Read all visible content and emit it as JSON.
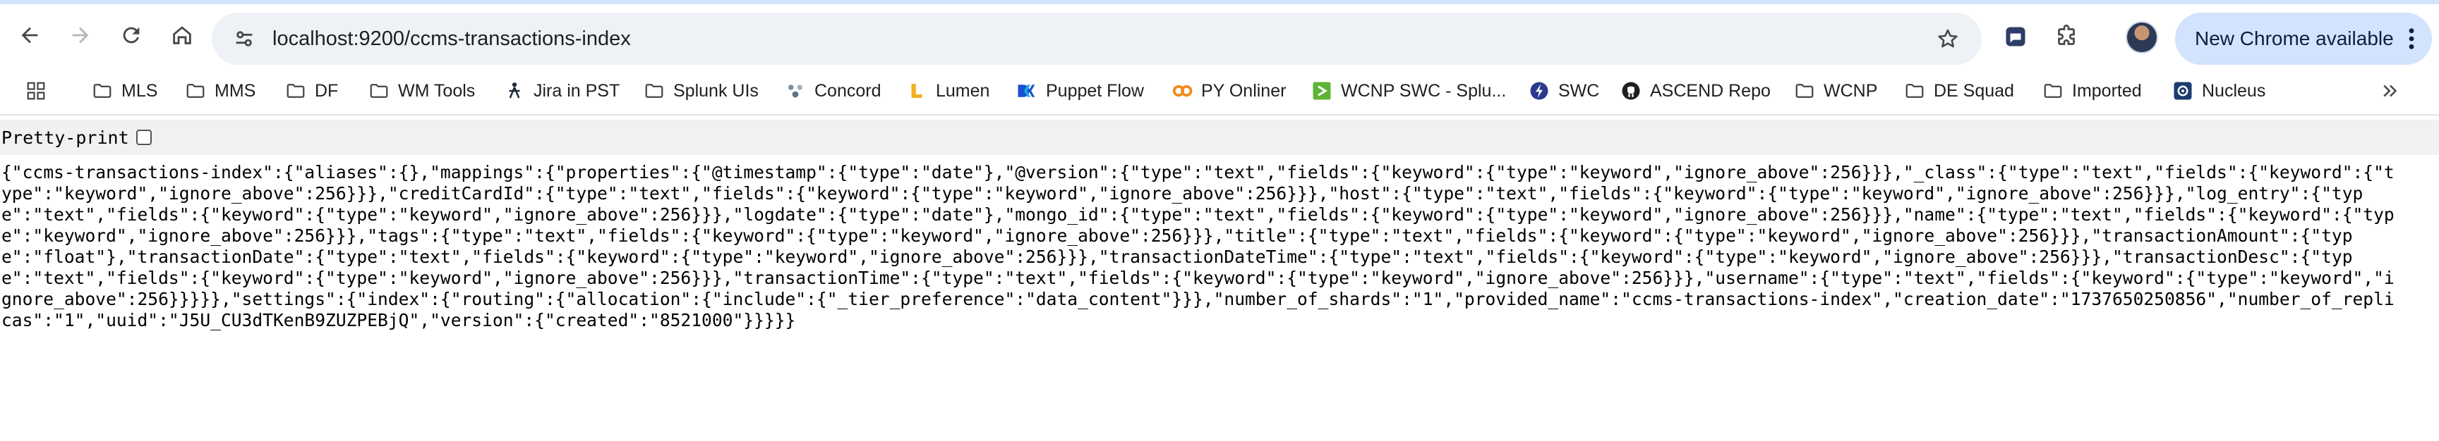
{
  "browser": {
    "url": "localhost:9200/ccms-transactions-index",
    "update_label": "New Chrome available"
  },
  "bookmarks": [
    {
      "label": "MLS",
      "icon": "folder-icon"
    },
    {
      "label": "MMS",
      "icon": "folder-icon"
    },
    {
      "label": "DF",
      "icon": "folder-icon"
    },
    {
      "label": "WM Tools",
      "icon": "folder-icon"
    },
    {
      "label": "Jira in PST",
      "icon": "jira-icon"
    },
    {
      "label": "Splunk UIs",
      "icon": "folder-icon"
    },
    {
      "label": "Concord",
      "icon": "concord-icon"
    },
    {
      "label": "Lumen",
      "icon": "lumen-icon"
    },
    {
      "label": "Puppet Flow",
      "icon": "dk-icon"
    },
    {
      "label": "PY Onliner",
      "icon": "co-icon"
    },
    {
      "label": "WCNP SWC - Splu...",
      "icon": "splunk-icon"
    },
    {
      "label": "SWC",
      "icon": "swc-icon"
    },
    {
      "label": "ASCEND Repo",
      "icon": "github-icon"
    },
    {
      "label": "WCNP",
      "icon": "folder-icon"
    },
    {
      "label": "DE Squad",
      "icon": "folder-icon"
    },
    {
      "label": "Imported",
      "icon": "folder-icon"
    },
    {
      "label": "Nucleus",
      "icon": "nucleus-icon"
    }
  ],
  "page": {
    "pretty_print_label": "Pretty-print",
    "pretty_print_checked": false,
    "json_text": "{\"ccms-transactions-index\":{\"aliases\":{},\"mappings\":{\"properties\":{\"@timestamp\":{\"type\":\"date\"},\"@version\":{\"type\":\"text\",\"fields\":{\"keyword\":{\"type\":\"keyword\",\"ignore_above\":256}}},\"_class\":{\"type\":\"text\",\"fields\":{\"keyword\":{\"type\":\"keyword\",\"ignore_above\":256}}},\"creditCardId\":{\"type\":\"text\",\"fields\":{\"keyword\":{\"type\":\"keyword\",\"ignore_above\":256}}},\"host\":{\"type\":\"text\",\"fields\":{\"keyword\":{\"type\":\"keyword\",\"ignore_above\":256}}},\"log_entry\":{\"type\":\"text\",\"fields\":{\"keyword\":{\"type\":\"keyword\",\"ignore_above\":256}}},\"logdate\":{\"type\":\"date\"},\"mongo_id\":{\"type\":\"text\",\"fields\":{\"keyword\":{\"type\":\"keyword\",\"ignore_above\":256}}},\"name\":{\"type\":\"text\",\"fields\":{\"keyword\":{\"type\":\"keyword\",\"ignore_above\":256}}},\"tags\":{\"type\":\"text\",\"fields\":{\"keyword\":{\"type\":\"keyword\",\"ignore_above\":256}}},\"title\":{\"type\":\"text\",\"fields\":{\"keyword\":{\"type\":\"keyword\",\"ignore_above\":256}}},\"transactionAmount\":{\"type\":\"float\"},\"transactionDate\":{\"type\":\"text\",\"fields\":{\"keyword\":{\"type\":\"keyword\",\"ignore_above\":256}}},\"transactionDateTime\":{\"type\":\"text\",\"fields\":{\"keyword\":{\"type\":\"keyword\",\"ignore_above\":256}}},\"transactionDesc\":{\"type\":\"text\",\"fields\":{\"keyword\":{\"type\":\"keyword\",\"ignore_above\":256}}},\"transactionTime\":{\"type\":\"text\",\"fields\":{\"keyword\":{\"type\":\"keyword\",\"ignore_above\":256}}},\"username\":{\"type\":\"text\",\"fields\":{\"keyword\":{\"type\":\"keyword\",\"ignore_above\":256}}}}},\"settings\":{\"index\":{\"routing\":{\"allocation\":{\"include\":{\"_tier_preference\":\"data_content\"}}},\"number_of_shards\":\"1\",\"provided_name\":\"ccms-transactions-index\",\"creation_date\":\"1737650250856\",\"number_of_replicas\":\"1\",\"uuid\":\"J5U_CU3dTKenB9ZUZPEBjQ\",\"version\":{\"created\":\"8521000\"}}}}}"
  },
  "colors": {
    "toolbar_accent": "#d3e3fd",
    "omnibox_bg": "#eef1f5",
    "bookmark_folder": "#444746"
  }
}
